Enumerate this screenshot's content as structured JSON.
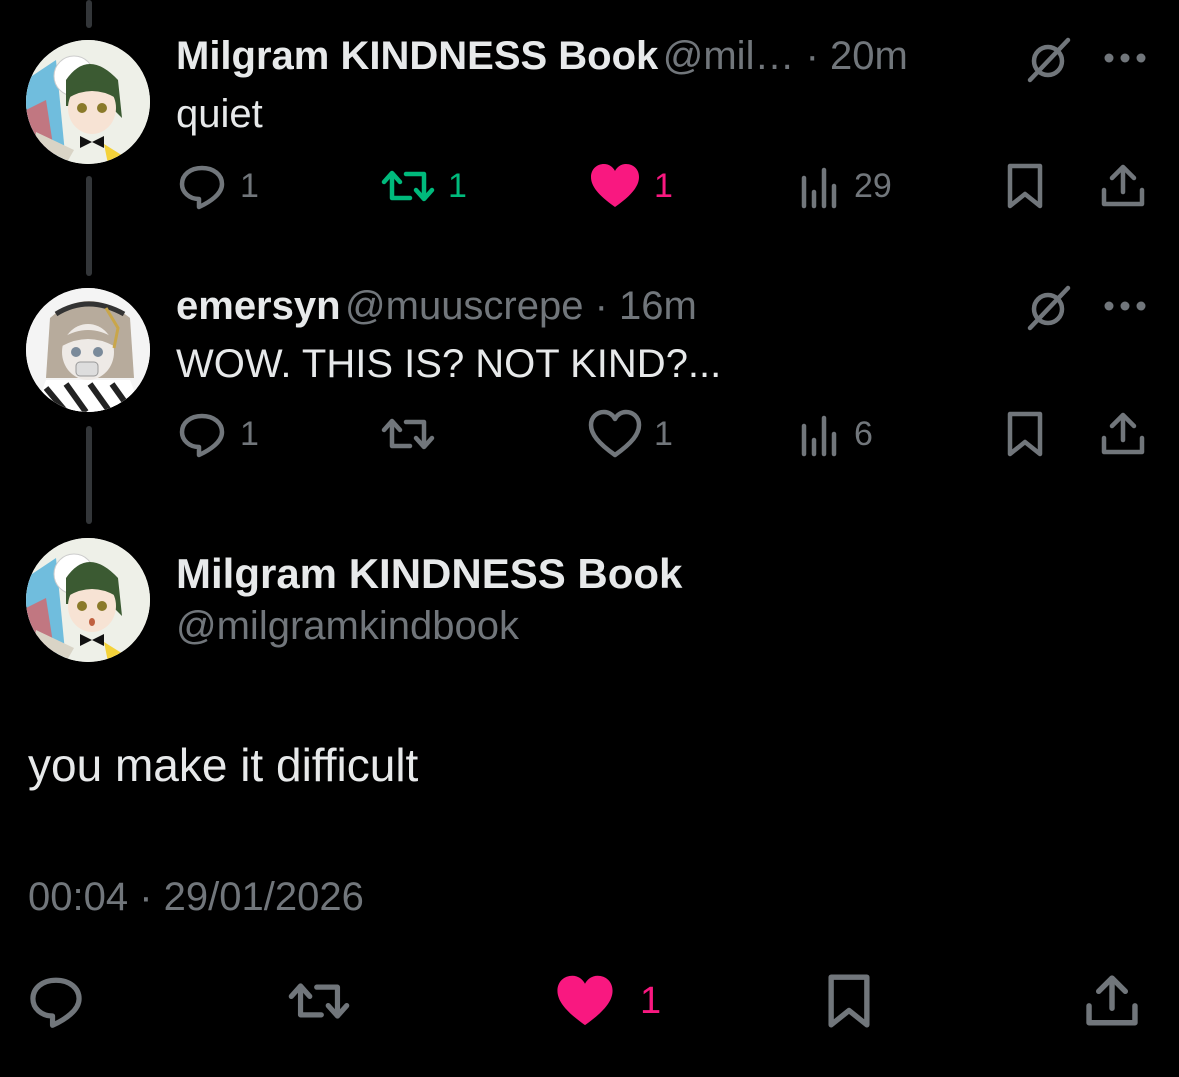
{
  "reply1": {
    "name": "Milgram KINDNESS Book",
    "handle_time": "@mil… · 20m",
    "text": "quiet",
    "actions": {
      "replies": "1",
      "reposts": "1",
      "likes": "1",
      "views": "29"
    },
    "reposted": true,
    "liked": true
  },
  "reply2": {
    "name": "emersyn",
    "handle_time": "@muuscrepe · 16m",
    "text": "WOW. THIS IS? NOT KIND?...",
    "actions": {
      "replies": "1",
      "reposts": "",
      "likes": "1",
      "views": "6"
    },
    "reposted": false,
    "liked": false
  },
  "main": {
    "name": "Milgram KINDNESS Book",
    "handle": "@milgramkindbook",
    "text": "you make it difficult",
    "timestamp": "00:04 · 29/01/2026",
    "likes": "1"
  },
  "colors": {
    "background": "#000000",
    "text": "#e7e9ea",
    "muted": "#71767b",
    "like": "#f91880",
    "repost": "#00ba7c",
    "thread": "#333639"
  },
  "icons": [
    "reply-icon",
    "repost-icon",
    "like-icon",
    "views-icon",
    "bookmark-icon",
    "share-icon",
    "grok-icon",
    "more-icon"
  ]
}
